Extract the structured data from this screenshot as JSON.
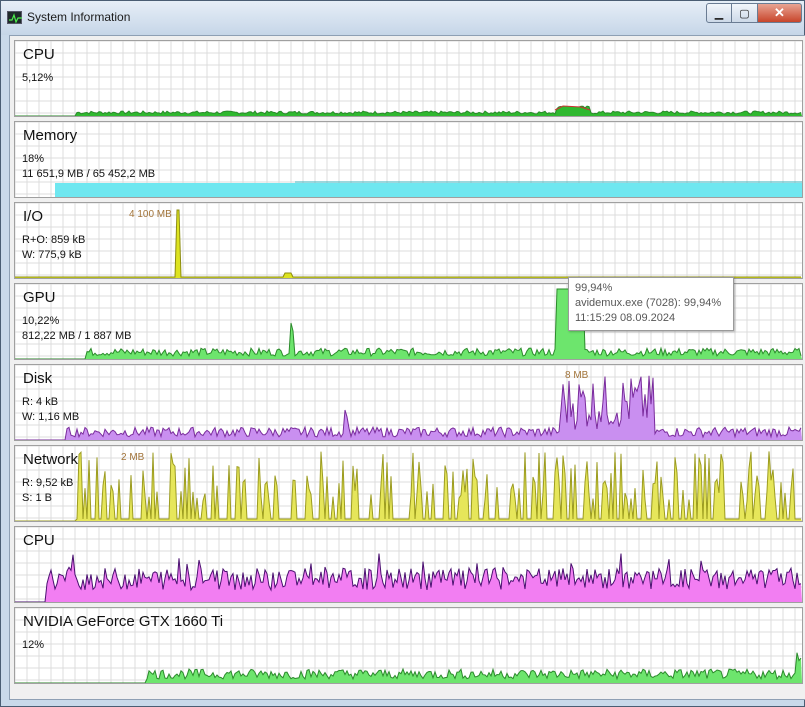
{
  "window": {
    "title": "System Information",
    "close_glyph": "✕",
    "min_glyph": "▁",
    "max_glyph": "▢"
  },
  "panels": [
    {
      "title": "CPU",
      "line1": "5,12%",
      "line2": "",
      "peak": "",
      "color": "#2eb82e",
      "color2": "#e03c3c"
    },
    {
      "title": "Memory",
      "line1": "18%",
      "line2": "11 651,9 MB / 65 452,2 MB",
      "peak": "",
      "color": "#6fe7f0"
    },
    {
      "title": "I/O",
      "line1": "R+O: 859 kB",
      "line2": "W: 775,9 kB",
      "peak": "4 100 MB",
      "color": "#dde320"
    },
    {
      "title": "GPU",
      "line1": "10,22%",
      "line2": "812,22 MB / 1 887 MB",
      "peak": "",
      "color": "#6de56d"
    },
    {
      "title": "Disk",
      "line1": "R: 4 kB",
      "line2": "W: 1,16 MB",
      "peak": "8 MB",
      "color": "#7a2c9c"
    },
    {
      "title": "Network",
      "line1": "R: 9,52 kB",
      "line2": "S: 1 B",
      "peak": "2 MB",
      "color": "#e6e65a"
    },
    {
      "title": "CPU",
      "line1": "",
      "line2": "",
      "peak": "",
      "color": "#f27ef2"
    },
    {
      "title": "NVIDIA GeForce GTX 1660 Ti",
      "line1": "12%",
      "line2": "",
      "peak": "",
      "color": "#6de56d"
    }
  ],
  "tooltip": {
    "value": "99,94%",
    "process": "avidemux.exe (7028): 99,94%",
    "time": "11:15:29 08.09.2024"
  },
  "icons": {
    "app": "activity-graph-icon",
    "minimize": "minimize-icon",
    "maximize": "maximize-icon",
    "close": "close-icon"
  }
}
